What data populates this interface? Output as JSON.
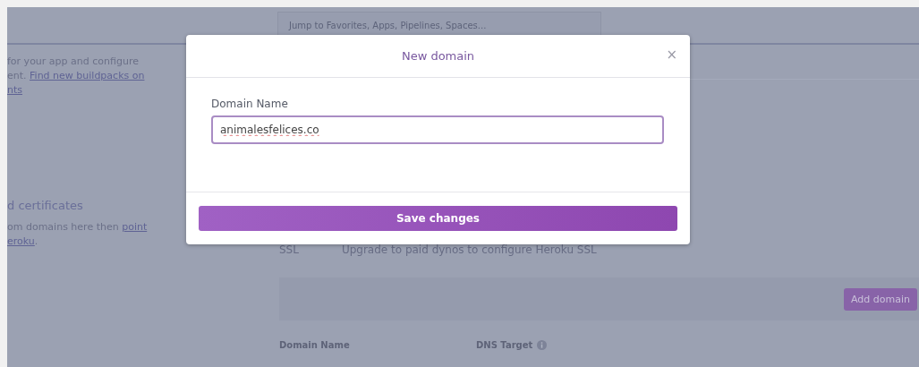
{
  "header": {
    "search": {
      "placeholder": "Jump to Favorites, Apps, Pipelines, Spaces..."
    }
  },
  "left_sections": [
    {
      "lines": [
        [
          {
            "text": "for your app and configure",
            "link": false
          }
        ],
        [
          {
            "text": "ent. ",
            "link": false
          },
          {
            "text": "Find new buildpacks on",
            "link": true
          }
        ],
        [
          {
            "text": "nts",
            "link": true
          }
        ]
      ]
    },
    {
      "heading": "d certificates",
      "lines": [
        [
          {
            "text": "om domains here then ",
            "link": false
          },
          {
            "text": "point",
            "link": true
          }
        ],
        [
          {
            "text": "eroku",
            "link": true
          },
          {
            "text": ".",
            "link": false
          }
        ]
      ]
    }
  ],
  "ssl": {
    "label": "SSL",
    "text": "Upgrade to paid dynos to configure Heroku SSL"
  },
  "add_domain_button": "Add domain",
  "table": {
    "columns": [
      {
        "label": "Domain Name",
        "kind": "plain"
      },
      {
        "label": "DNS Target",
        "kind": "info"
      }
    ]
  },
  "modal": {
    "title": "New domain",
    "close": "×",
    "field_label": "Domain Name",
    "field_value": "animalesfelices.co",
    "save_button": "Save changes"
  }
}
